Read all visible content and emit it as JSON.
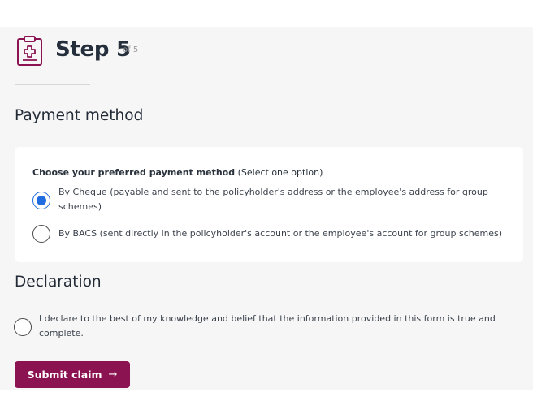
{
  "step": {
    "title": "Step 5",
    "of": "of 5",
    "icon": "clipboard-medical-icon"
  },
  "payment": {
    "heading": "Payment method",
    "question_bold": "Choose your preferred payment method",
    "question_hint": "(Select one option)",
    "options": [
      {
        "label": "By Cheque (payable and sent to the policyholder's address or the employee's address for group schemes)",
        "selected": true
      },
      {
        "label": "By BACS (sent directly in the policyholder's account or the employee's account for group schemes)",
        "selected": false
      }
    ]
  },
  "declaration": {
    "heading": "Declaration",
    "text": "I declare to the best of my knowledge and belief that the information provided in this form is true and complete.",
    "checked": false
  },
  "submit": {
    "label": "Submit claim",
    "icon": "arrow-right-icon"
  },
  "colors": {
    "accent": "#8c1351",
    "radio_selected": "#1f6ce0"
  }
}
